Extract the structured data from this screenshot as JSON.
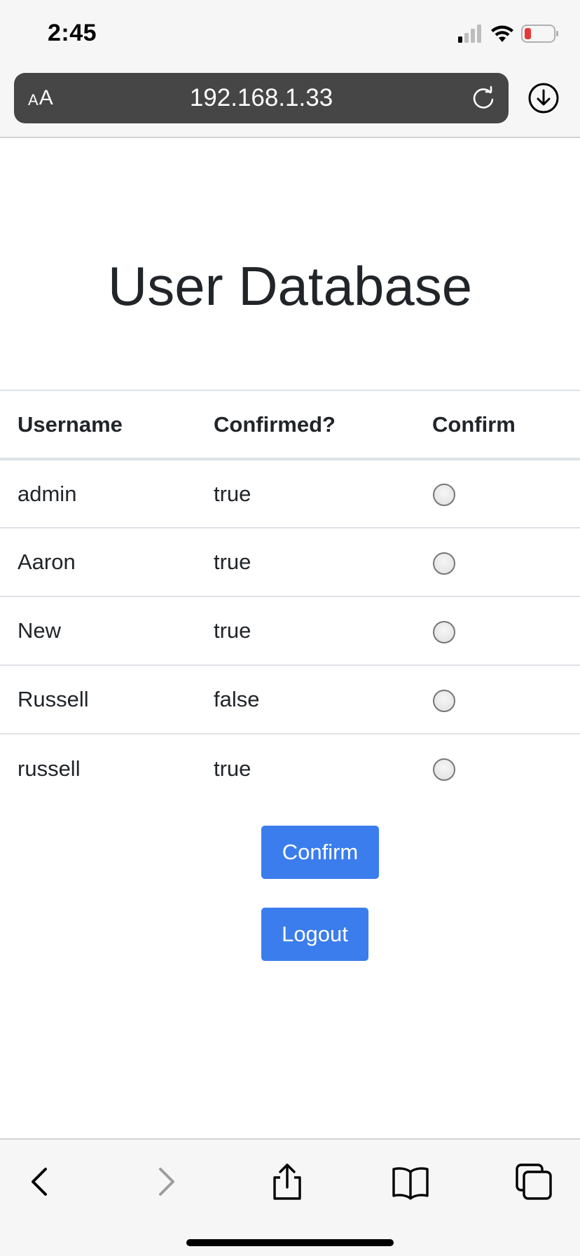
{
  "status_bar": {
    "time": "2:45",
    "icons": [
      "signal-icon",
      "wifi-icon",
      "battery-icon"
    ],
    "battery_color": "#e53935"
  },
  "browser": {
    "text_size_label_small": "A",
    "text_size_label_large": "A",
    "url": "192.168.1.33",
    "icons": [
      "reload-icon",
      "download-icon"
    ]
  },
  "page": {
    "title": "User Database",
    "table": {
      "headers": [
        "Username",
        "Confirmed?",
        "Confirm"
      ],
      "rows": [
        {
          "username": "admin",
          "confirmed": "true"
        },
        {
          "username": "Aaron",
          "confirmed": "true"
        },
        {
          "username": "New",
          "confirmed": "true"
        },
        {
          "username": "Russell",
          "confirmed": "false"
        },
        {
          "username": "russell",
          "confirmed": "true"
        }
      ]
    },
    "confirm_button": "Confirm",
    "logout_button": "Logout",
    "accent_color": "#3b7ded"
  },
  "toolbar": {
    "icons": [
      "back-icon",
      "forward-icon",
      "share-icon",
      "bookmarks-icon",
      "tabs-icon"
    ]
  }
}
